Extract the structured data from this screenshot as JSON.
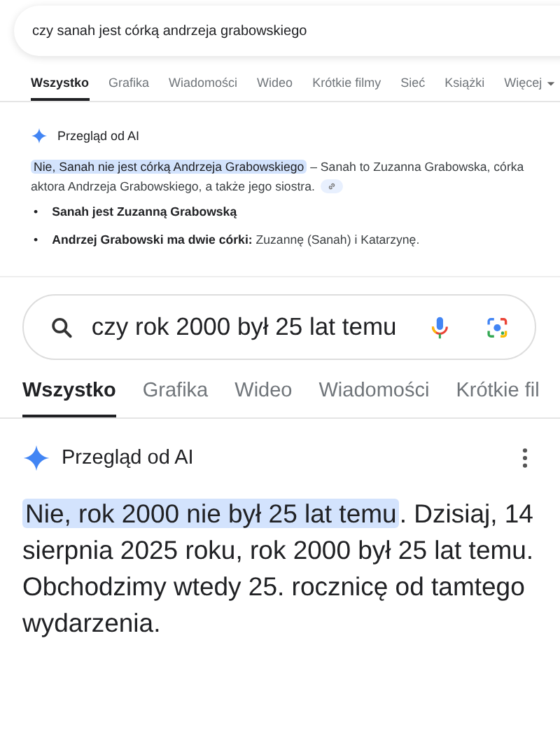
{
  "panels": [
    {
      "search": {
        "value": "czy sanah jest córką andrzeja grabowskiego",
        "icons": false
      },
      "tabs": [
        {
          "label": "Wszystko",
          "selected": true
        },
        {
          "label": "Grafika",
          "selected": false
        },
        {
          "label": "Wiadomości",
          "selected": false
        },
        {
          "label": "Wideo",
          "selected": false
        },
        {
          "label": "Krótkie filmy",
          "selected": false
        },
        {
          "label": "Sieć",
          "selected": false
        },
        {
          "label": "Książki",
          "selected": false
        },
        {
          "label": "Więcej",
          "selected": false,
          "dropdown": true
        }
      ],
      "ai": {
        "title": "Przegląd od AI",
        "menu": false,
        "highlight": "Nie, Sanah nie jest córką Andrzeja Grabowskiego",
        "text": " – Sanah to Zuzanna Grabowska, córka aktora Andrzeja Grabowskiego, a także jego siostra.",
        "link_chip": true,
        "bullets": [
          {
            "marker": "•",
            "label": "Sanah jest Zuzanną Grabowską"
          },
          {
            "marker": "•",
            "label": "Andrzej Grabowski ma dwie córki:",
            "text": " Zuzannę (Sanah) i Katarzynę."
          }
        ]
      }
    },
    {
      "search": {
        "value": "czy rok 2000 był 25 lat temu",
        "icons": true
      },
      "tabs": [
        {
          "label": "Wszystko",
          "selected": true
        },
        {
          "label": "Grafika",
          "selected": false
        },
        {
          "label": "Wideo",
          "selected": false
        },
        {
          "label": "Wiadomości",
          "selected": false
        },
        {
          "label": "Krótkie fil",
          "selected": false
        }
      ],
      "ai": {
        "title": "Przegląd od AI",
        "menu": true,
        "highlight": "Nie, rok 2000 nie był 25 lat temu",
        "text": ". Dzisiaj, 14 sierpnia 2025 roku, rok 2000 był 25 lat temu. Obchodzimy wtedy 25. rocznicę od tamtego wydarzenia.",
        "link_chip": false
      }
    }
  ]
}
